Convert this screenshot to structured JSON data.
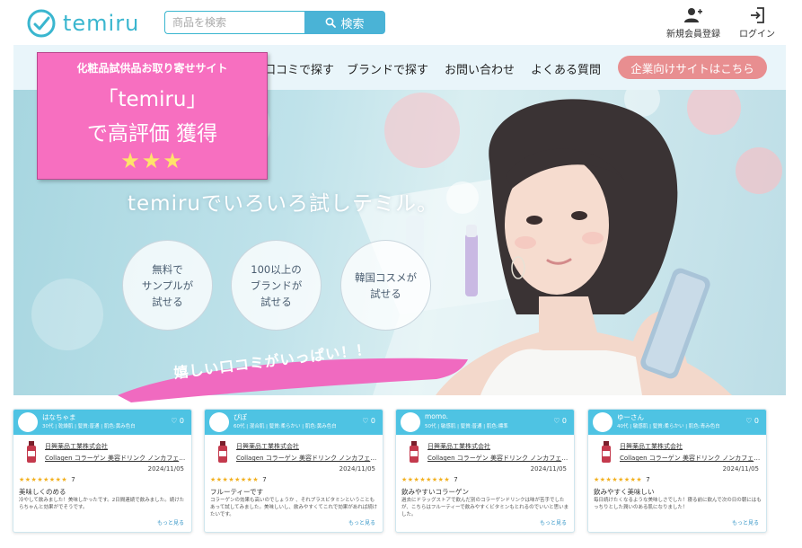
{
  "header": {
    "logo_text": "temiru",
    "search_placeholder": "商品を検索",
    "search_button": "検索",
    "register_label": "新規会員登録",
    "login_label": "ログイン",
    "accent": "#3ab6cf"
  },
  "nav": {
    "items": [
      "口コミで探す",
      "ブランドで探す",
      "お問い合わせ",
      "よくある質問"
    ],
    "cta": "企業向けサイトはこちら",
    "cta_color": "#e88e90"
  },
  "badge": {
    "line1": "化粧品試供品お取り寄せサイト",
    "line2": "「temiru」",
    "line3": "で高評価 獲得",
    "stars": "★★★",
    "color": "#f76fc0"
  },
  "hero": {
    "tagline": "temiruでいろいろ試しテミル。",
    "circles": [
      "無料で\nサンプルが\n試せる",
      "100以上の\nブランドが\n試せる",
      "韓国コスメが\n試せる"
    ]
  },
  "swoosh_text": "嬉しい口コミがいっぱい！！",
  "reviews": [
    {
      "user": "はなちゃま",
      "attrs": "30代 | 乾燥肌 | 髪質:普通 | 肌色:黄み色白",
      "likes": "♡ 0",
      "maker": "日興薬品工業株式会社",
      "product": "Collagen コラーゲン 美容ドリンク ノンカフェイン",
      "date": "2024/11/05",
      "stars": "★★★★★★★★",
      "score": "7",
      "title": "美味しくのめる",
      "body": "冷やして飲みました！美味しかったです。2日間連続で飲みました。続けたらちゃんと効果がでそうです。",
      "more": "もっと見る"
    },
    {
      "user": "ぴぽ",
      "attrs": "60代 | 混合肌 | 髪質:柔らかい | 肌色:黄み色白",
      "likes": "♡ 0",
      "maker": "日興薬品工業株式会社",
      "product": "Collagen コラーゲン 美容ドリンク ノンカフェイン",
      "date": "2024/11/05",
      "stars": "★★★★★★★★",
      "score": "7",
      "title": "フルーティーです",
      "body": "コラーゲンの効果も高いのでしょうか 、それプラスビタミンということもあって試してみました。美味しいし、飲みやすくてこれで効果があれば続けたいです。",
      "more": "もっと見る"
    },
    {
      "user": "momo.",
      "attrs": "50代 | 敏感肌 | 髪質:普通 | 肌色:標準",
      "likes": "♡ 0",
      "maker": "日興薬品工業株式会社",
      "product": "Collagen コラーゲン 美容ドリンク ノンカフェイン",
      "date": "2024/11/05",
      "stars": "★★★★★★★★",
      "score": "7",
      "title": "飲みやすいコラーゲン",
      "body": "過去にドラッグストアで飲んだ別のコラーゲンドリンクは味が苦手でしたが、こちらはフルーティーで飲みやすくビタミンもとれるのでいいと思いました。",
      "more": "もっと見る"
    },
    {
      "user": "ゆーさん",
      "attrs": "40代 | 敏感肌 | 髪質:柔らかい | 肌色:青み色白",
      "likes": "♡ 0",
      "maker": "日興薬品工業株式会社",
      "product": "Collagen コラーゲン 美容ドリンク ノンカフェイン",
      "date": "2024/11/05",
      "stars": "★★★★★★★★",
      "score": "7",
      "title": "飲みやすく美味しい",
      "body": "毎日続けたくなるような美味しさでした！寝る前に飲んで次の日の朝にはもっちりとした潤いのある肌になりました！",
      "more": "もっと見る"
    }
  ]
}
